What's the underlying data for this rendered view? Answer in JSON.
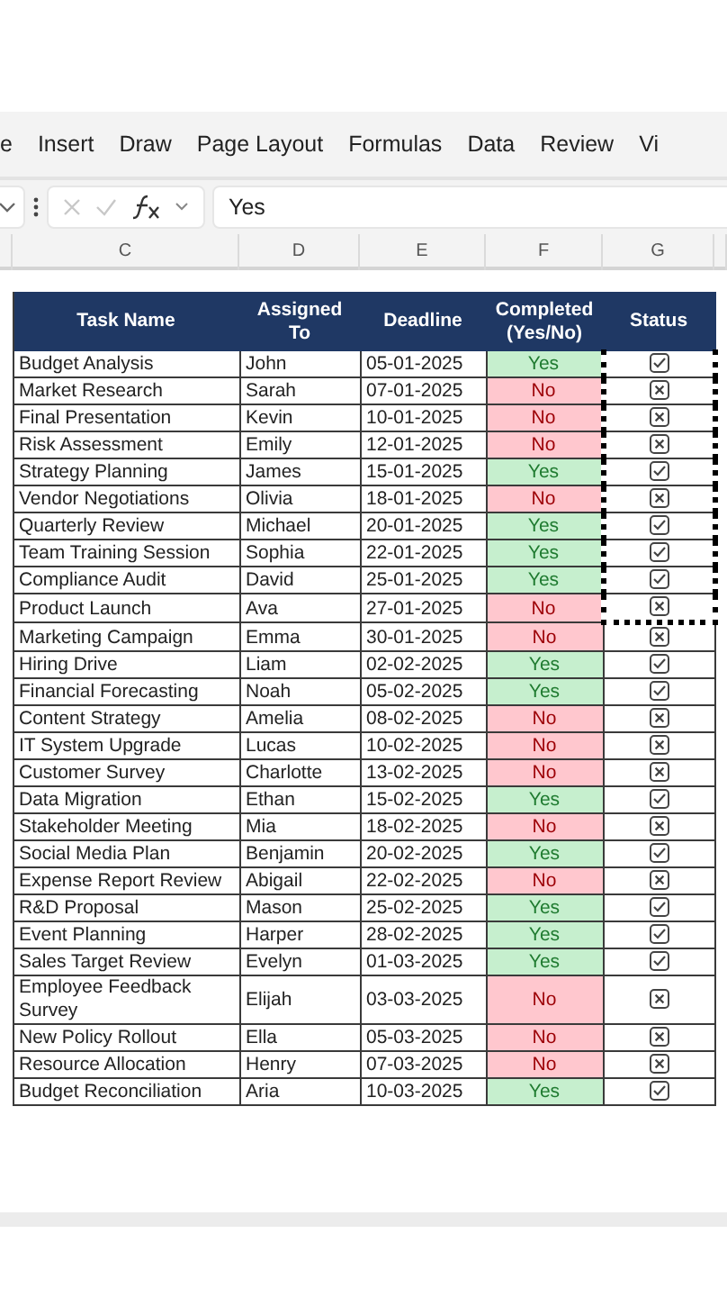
{
  "ribbon": {
    "tabs": [
      "e",
      "Insert",
      "Draw",
      "Page Layout",
      "Formulas",
      "Data",
      "Review",
      "Vi"
    ]
  },
  "formula_bar": {
    "value": "Yes"
  },
  "column_headers": [
    "C",
    "D",
    "E",
    "F",
    "G"
  ],
  "table": {
    "columns": [
      "Task Name",
      "Assigned To",
      "Deadline",
      "Completed (Yes/No)",
      "Status"
    ],
    "rows": [
      {
        "task": "Budget Analysis",
        "assigned": "John",
        "deadline": "05-01-2025",
        "completed": "Yes",
        "done": true,
        "in_copy_range": true
      },
      {
        "task": "Market Research",
        "assigned": "Sarah",
        "deadline": "07-01-2025",
        "completed": "No",
        "done": false,
        "in_copy_range": true
      },
      {
        "task": "Final Presentation",
        "assigned": "Kevin",
        "deadline": "10-01-2025",
        "completed": "No",
        "done": false,
        "in_copy_range": true
      },
      {
        "task": "Risk Assessment",
        "assigned": "Emily",
        "deadline": "12-01-2025",
        "completed": "No",
        "done": false,
        "in_copy_range": true
      },
      {
        "task": "Strategy Planning",
        "assigned": "James",
        "deadline": "15-01-2025",
        "completed": "Yes",
        "done": true,
        "in_copy_range": true
      },
      {
        "task": "Vendor Negotiations",
        "assigned": "Olivia",
        "deadline": "18-01-2025",
        "completed": "No",
        "done": false,
        "in_copy_range": true
      },
      {
        "task": "Quarterly Review",
        "assigned": "Michael",
        "deadline": "20-01-2025",
        "completed": "Yes",
        "done": true,
        "in_copy_range": true
      },
      {
        "task": "Team Training Session",
        "assigned": "Sophia",
        "deadline": "22-01-2025",
        "completed": "Yes",
        "done": true,
        "in_copy_range": true
      },
      {
        "task": "Compliance Audit",
        "assigned": "David",
        "deadline": "25-01-2025",
        "completed": "Yes",
        "done": true,
        "in_copy_range": true
      },
      {
        "task": "Product Launch",
        "assigned": "Ava",
        "deadline": "27-01-2025",
        "completed": "No",
        "done": false,
        "in_copy_range": true
      },
      {
        "task": "Marketing Campaign",
        "assigned": "Emma",
        "deadline": "30-01-2025",
        "completed": "No",
        "done": false,
        "in_copy_range": false
      },
      {
        "task": "Hiring Drive",
        "assigned": "Liam",
        "deadline": "02-02-2025",
        "completed": "Yes",
        "done": true,
        "in_copy_range": false
      },
      {
        "task": "Financial Forecasting",
        "assigned": "Noah",
        "deadline": "05-02-2025",
        "completed": "Yes",
        "done": true,
        "in_copy_range": false
      },
      {
        "task": "Content Strategy",
        "assigned": "Amelia",
        "deadline": "08-02-2025",
        "completed": "No",
        "done": false,
        "in_copy_range": false
      },
      {
        "task": "IT System Upgrade",
        "assigned": "Lucas",
        "deadline": "10-02-2025",
        "completed": "No",
        "done": false,
        "in_copy_range": false
      },
      {
        "task": "Customer Survey",
        "assigned": "Charlotte",
        "deadline": "13-02-2025",
        "completed": "No",
        "done": false,
        "in_copy_range": false
      },
      {
        "task": "Data Migration",
        "assigned": "Ethan",
        "deadline": "15-02-2025",
        "completed": "Yes",
        "done": true,
        "in_copy_range": false
      },
      {
        "task": "Stakeholder Meeting",
        "assigned": "Mia",
        "deadline": "18-02-2025",
        "completed": "No",
        "done": false,
        "in_copy_range": false
      },
      {
        "task": "Social Media Plan",
        "assigned": "Benjamin",
        "deadline": "20-02-2025",
        "completed": "Yes",
        "done": true,
        "in_copy_range": false
      },
      {
        "task": "Expense Report Review",
        "assigned": "Abigail",
        "deadline": "22-02-2025",
        "completed": "No",
        "done": false,
        "in_copy_range": false
      },
      {
        "task": "R&D Proposal",
        "assigned": "Mason",
        "deadline": "25-02-2025",
        "completed": "Yes",
        "done": true,
        "in_copy_range": false
      },
      {
        "task": "Event Planning",
        "assigned": "Harper",
        "deadline": "28-02-2025",
        "completed": "Yes",
        "done": true,
        "in_copy_range": false
      },
      {
        "task": "Sales Target Review",
        "assigned": "Evelyn",
        "deadline": "01-03-2025",
        "completed": "Yes",
        "done": true,
        "in_copy_range": false
      },
      {
        "task": "Employee Feedback Survey",
        "assigned": "Elijah",
        "deadline": "03-03-2025",
        "completed": "No",
        "done": false,
        "in_copy_range": false
      },
      {
        "task": "New Policy Rollout",
        "assigned": "Ella",
        "deadline": "05-03-2025",
        "completed": "No",
        "done": false,
        "in_copy_range": false
      },
      {
        "task": "Resource Allocation",
        "assigned": "Henry",
        "deadline": "07-03-2025",
        "completed": "No",
        "done": false,
        "in_copy_range": false
      },
      {
        "task": "Budget Reconciliation",
        "assigned": "Aria",
        "deadline": "10-03-2025",
        "completed": "Yes",
        "done": true,
        "in_copy_range": false
      }
    ]
  }
}
